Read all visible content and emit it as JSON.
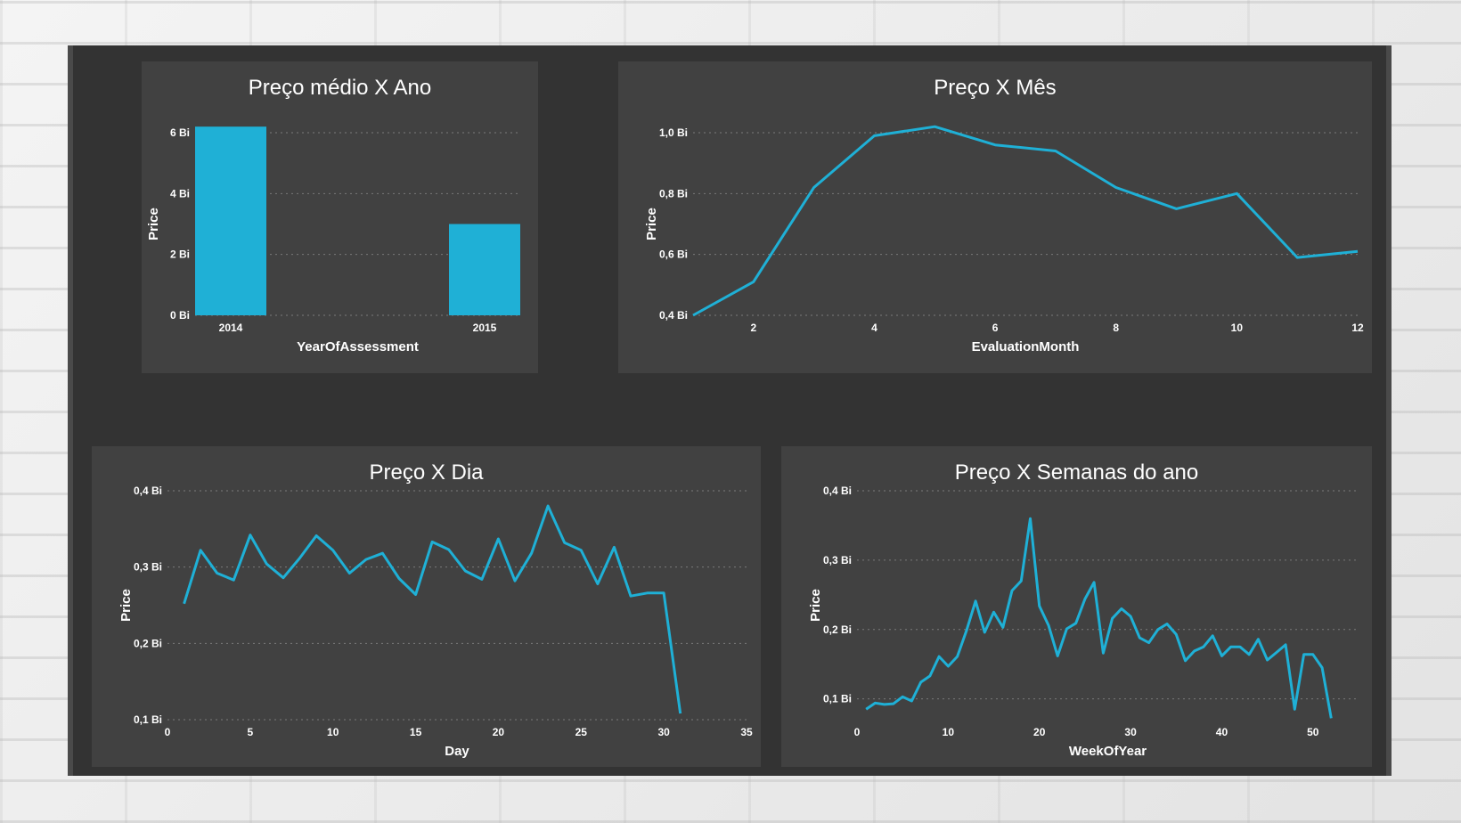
{
  "colors": {
    "accent": "#1fb0d6",
    "panel": "#414141",
    "frame": "#333333"
  },
  "chart_data": [
    {
      "type": "bar",
      "title": "Preço médio X Ano",
      "xlabel": "YearOfAssessment",
      "ylabel": "Price",
      "categories": [
        "2014",
        "2015"
      ],
      "values": [
        6.2,
        3.0
      ],
      "ylim": [
        0,
        6
      ],
      "yticks": [
        0,
        2,
        4,
        6
      ],
      "ytick_labels": [
        "0 Bi",
        "2 Bi",
        "4 Bi",
        "6 Bi"
      ],
      "grid": true
    },
    {
      "type": "line",
      "title": "Preço X Mês",
      "xlabel": "EvaluationMonth",
      "ylabel": "Price",
      "x": [
        1,
        2,
        3,
        4,
        5,
        6,
        7,
        8,
        9,
        10,
        11,
        12
      ],
      "values": [
        0.4,
        0.51,
        0.82,
        0.99,
        1.02,
        0.96,
        0.94,
        0.82,
        0.75,
        0.8,
        0.59,
        0.61
      ],
      "xlim": [
        1,
        12
      ],
      "ylim": [
        0.4,
        1.0
      ],
      "xticks": [
        2,
        4,
        6,
        8,
        10,
        12
      ],
      "yticks": [
        0.4,
        0.6,
        0.8,
        1.0
      ],
      "ytick_labels": [
        "0,4 Bi",
        "0,6 Bi",
        "0,8 Bi",
        "1,0 Bi"
      ],
      "grid": true
    },
    {
      "type": "line",
      "title": "Preço X Dia",
      "xlabel": "Day",
      "ylabel": "Price",
      "x": [
        1,
        2,
        3,
        4,
        5,
        6,
        7,
        8,
        9,
        10,
        11,
        12,
        13,
        14,
        15,
        16,
        17,
        18,
        19,
        20,
        21,
        22,
        23,
        24,
        25,
        26,
        27,
        28,
        29,
        30,
        31
      ],
      "values": [
        0.252,
        0.322,
        0.292,
        0.283,
        0.342,
        0.304,
        0.286,
        0.312,
        0.341,
        0.322,
        0.292,
        0.31,
        0.318,
        0.285,
        0.264,
        0.333,
        0.323,
        0.295,
        0.284,
        0.337,
        0.282,
        0.318,
        0.38,
        0.332,
        0.322,
        0.278,
        0.326,
        0.262,
        0.266,
        0.266,
        0.108
      ],
      "xlim": [
        0,
        35
      ],
      "ylim": [
        0.1,
        0.4
      ],
      "xticks": [
        0,
        5,
        10,
        15,
        20,
        25,
        30,
        35
      ],
      "yticks": [
        0.1,
        0.2,
        0.3,
        0.4
      ],
      "ytick_labels": [
        "0,1 Bi",
        "0,2 Bi",
        "0,3 Bi",
        "0,4 Bi"
      ],
      "grid": true
    },
    {
      "type": "line",
      "title": "Preço X Semanas do ano",
      "xlabel": "WeekOfYear",
      "ylabel": "Price",
      "x": [
        1,
        2,
        3,
        4,
        5,
        6,
        7,
        8,
        9,
        10,
        11,
        12,
        13,
        14,
        15,
        16,
        17,
        18,
        19,
        20,
        21,
        22,
        23,
        24,
        25,
        26,
        27,
        28,
        29,
        30,
        31,
        32,
        33,
        34,
        35,
        36,
        37,
        38,
        39,
        40,
        41,
        42,
        43,
        44,
        45,
        46,
        47,
        48,
        49,
        50,
        51,
        52
      ],
      "values": [
        0.085,
        0.094,
        0.092,
        0.093,
        0.103,
        0.097,
        0.124,
        0.133,
        0.161,
        0.147,
        0.161,
        0.198,
        0.241,
        0.196,
        0.225,
        0.203,
        0.256,
        0.27,
        0.36,
        0.234,
        0.206,
        0.162,
        0.201,
        0.209,
        0.244,
        0.268,
        0.166,
        0.216,
        0.23,
        0.219,
        0.188,
        0.181,
        0.2,
        0.208,
        0.193,
        0.155,
        0.169,
        0.175,
        0.191,
        0.162,
        0.175,
        0.175,
        0.164,
        0.186,
        0.156,
        0.167,
        0.178,
        0.085,
        0.164,
        0.164,
        0.145,
        0.072
      ],
      "xlim": [
        0,
        55
      ],
      "ylim": [
        0.07,
        0.4
      ],
      "xticks": [
        0,
        10,
        20,
        30,
        40,
        50
      ],
      "yticks": [
        0.1,
        0.2,
        0.3,
        0.4
      ],
      "ytick_labels": [
        "0,1 Bi",
        "0,2 Bi",
        "0,3 Bi",
        "0,4 Bi"
      ],
      "grid": true
    }
  ]
}
